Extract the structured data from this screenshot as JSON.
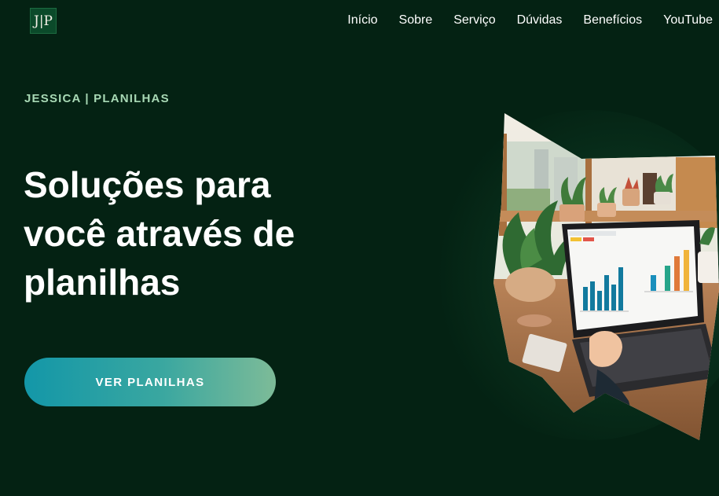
{
  "brand": {
    "logo_text": "J|P"
  },
  "nav": {
    "items": [
      {
        "label": "Início"
      },
      {
        "label": "Sobre"
      },
      {
        "label": "Serviço"
      },
      {
        "label": "Dúvidas"
      },
      {
        "label": "Benefícios"
      },
      {
        "label": "YouTube"
      }
    ]
  },
  "hero": {
    "eyebrow": "JESSICA | PLANILHAS",
    "title_lines": [
      "Soluções para",
      "você através de",
      "planilhas"
    ],
    "cta_label": "VER PLANILHAS",
    "image_subject": "laptop-with-spreadsheet-charts-and-plants"
  },
  "colors": {
    "background": "#042213",
    "eyebrow": "#a8d9b5",
    "cta_start": "#1397a8",
    "cta_end": "#7dbb98"
  }
}
